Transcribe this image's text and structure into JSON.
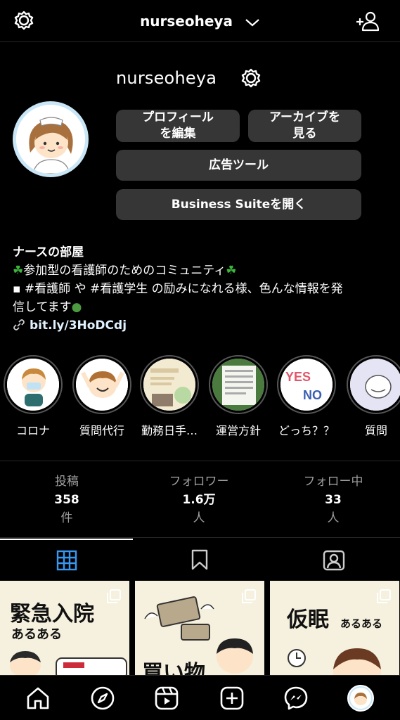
{
  "header": {
    "username": "nurseoheya"
  },
  "profile": {
    "name": "nurseoheya",
    "buttons": {
      "edit_line1": "プロフィール",
      "edit_line2": "を編集",
      "archive_line1": "アーカイブを",
      "archive_line2": "見る",
      "ads": "広告ツール",
      "suite": "Business Suiteを開く"
    },
    "bio": {
      "title": "ナースの部屋",
      "line1": "参加型の看護師のためのコミュニティ",
      "line2_prefix": "▪ #看護師 や #看護学生 の励みになれる様、色んな情報を発",
      "line3": "信してます",
      "link": "bit.ly/3HoDCdj"
    }
  },
  "highlights": [
    {
      "label": "コロナ"
    },
    {
      "label": "質問代行"
    },
    {
      "label": "勤務日手…"
    },
    {
      "label": "運営方針"
    },
    {
      "label": "どっち？？"
    },
    {
      "label": "質問"
    }
  ],
  "highlight_art": {
    "yes": "YES",
    "no": "NO"
  },
  "stats": [
    {
      "key": "投稿",
      "value": "358",
      "unit": "件"
    },
    {
      "key": "フォロワー",
      "value": "1.6万",
      "unit": "人"
    },
    {
      "key": "フォロー中",
      "value": "33",
      "unit": "人"
    }
  ],
  "posts": [
    {
      "title": "緊急入院",
      "sub": "あるある"
    },
    {
      "title": "買い物",
      "sub": ""
    },
    {
      "title": "仮眠",
      "sub": "あるある"
    }
  ],
  "colors": {
    "background": "#000000",
    "button": "#363636",
    "divider": "#262626",
    "grid_active": "#3897f0"
  }
}
